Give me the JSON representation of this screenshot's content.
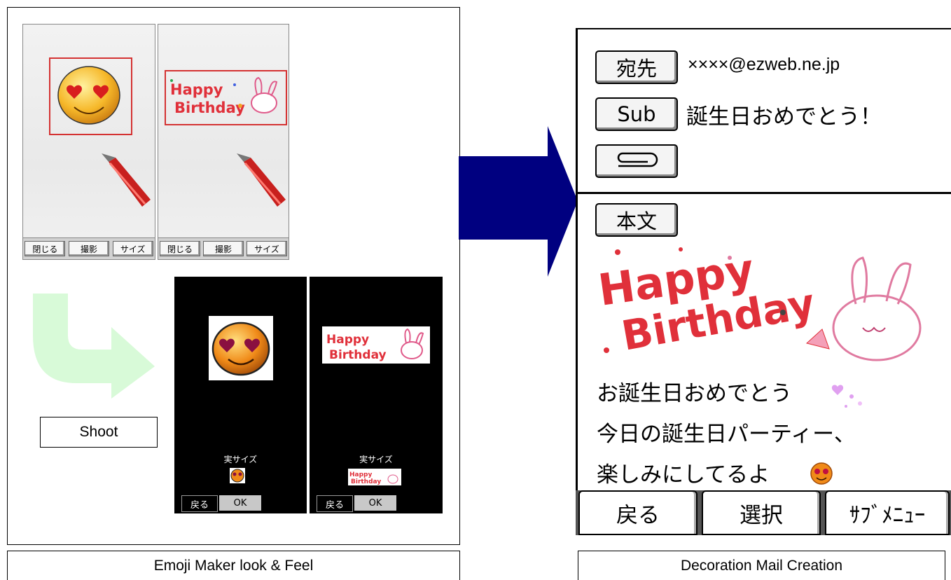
{
  "left": {
    "caption": "Emoji Maker look & Feel",
    "shoot_label": "Shoot",
    "camera_keys": [
      "閉じる",
      "撮影",
      "サイズ"
    ],
    "preview_size_label": "実サイズ",
    "preview_keys": [
      "戻る",
      "OK"
    ]
  },
  "right": {
    "caption": "Decoration Mail Creation",
    "to_button": "宛先",
    "to_value": "××××@ezweb.ne.jp",
    "sub_button": "Sub",
    "sub_value": "誕生日おめでとう！",
    "body_button": "本文",
    "body_lines": [
      "お誕生日おめでとう",
      "今日の誕生日パーティー、",
      "楽しみにしてるよ"
    ],
    "bottom_keys": [
      "戻る",
      "選択",
      "ｻﾌﾞﾒﾆｭｰ"
    ]
  },
  "colors": {
    "arrow": "#000080",
    "curved_arrow": "#d8fad8",
    "frame_red": "#d43232",
    "sticker_red": "#e0303a"
  },
  "icons": {
    "emoji": "heart-eyes-smiley-icon",
    "sticker": "happy-birthday-rabbit-sticker",
    "pen": "red-pen-image",
    "attach": "paperclip-icon"
  }
}
